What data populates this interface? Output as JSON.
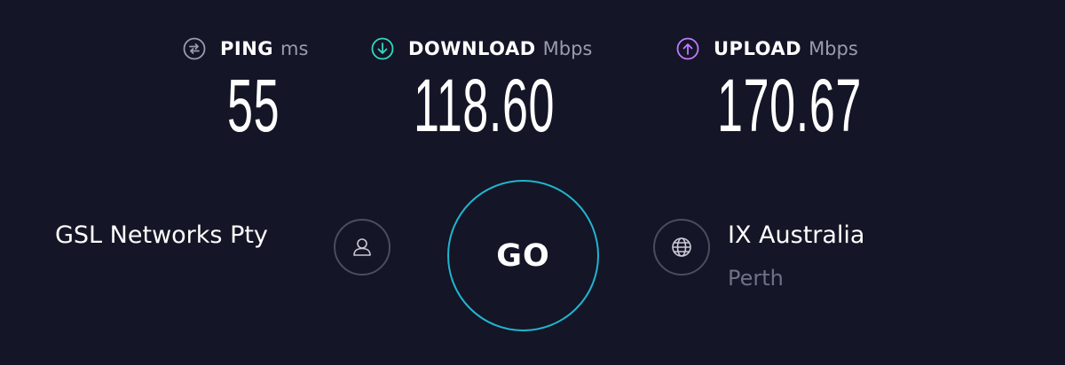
{
  "metrics": {
    "ping": {
      "name": "PING",
      "unit": "ms",
      "value": "55",
      "icon": "ping-icon",
      "color": "#9a9cae"
    },
    "download": {
      "name": "DOWNLOAD",
      "unit": "Mbps",
      "value": "118.60",
      "icon": "download-arrow-icon",
      "color": "#35d6c0"
    },
    "upload": {
      "name": "UPLOAD",
      "unit": "Mbps",
      "value": "170.67",
      "icon": "upload-arrow-icon",
      "color": "#c07bff"
    }
  },
  "provider": {
    "name": "GSL Networks Pty",
    "icon": "user-icon"
  },
  "go": {
    "label": "GO",
    "ring_color": "#1fb5cf"
  },
  "server": {
    "name": "IX Australia",
    "location": "Perth",
    "icon": "globe-icon"
  },
  "colors": {
    "background": "#141526",
    "muted": "#9a9cae"
  }
}
